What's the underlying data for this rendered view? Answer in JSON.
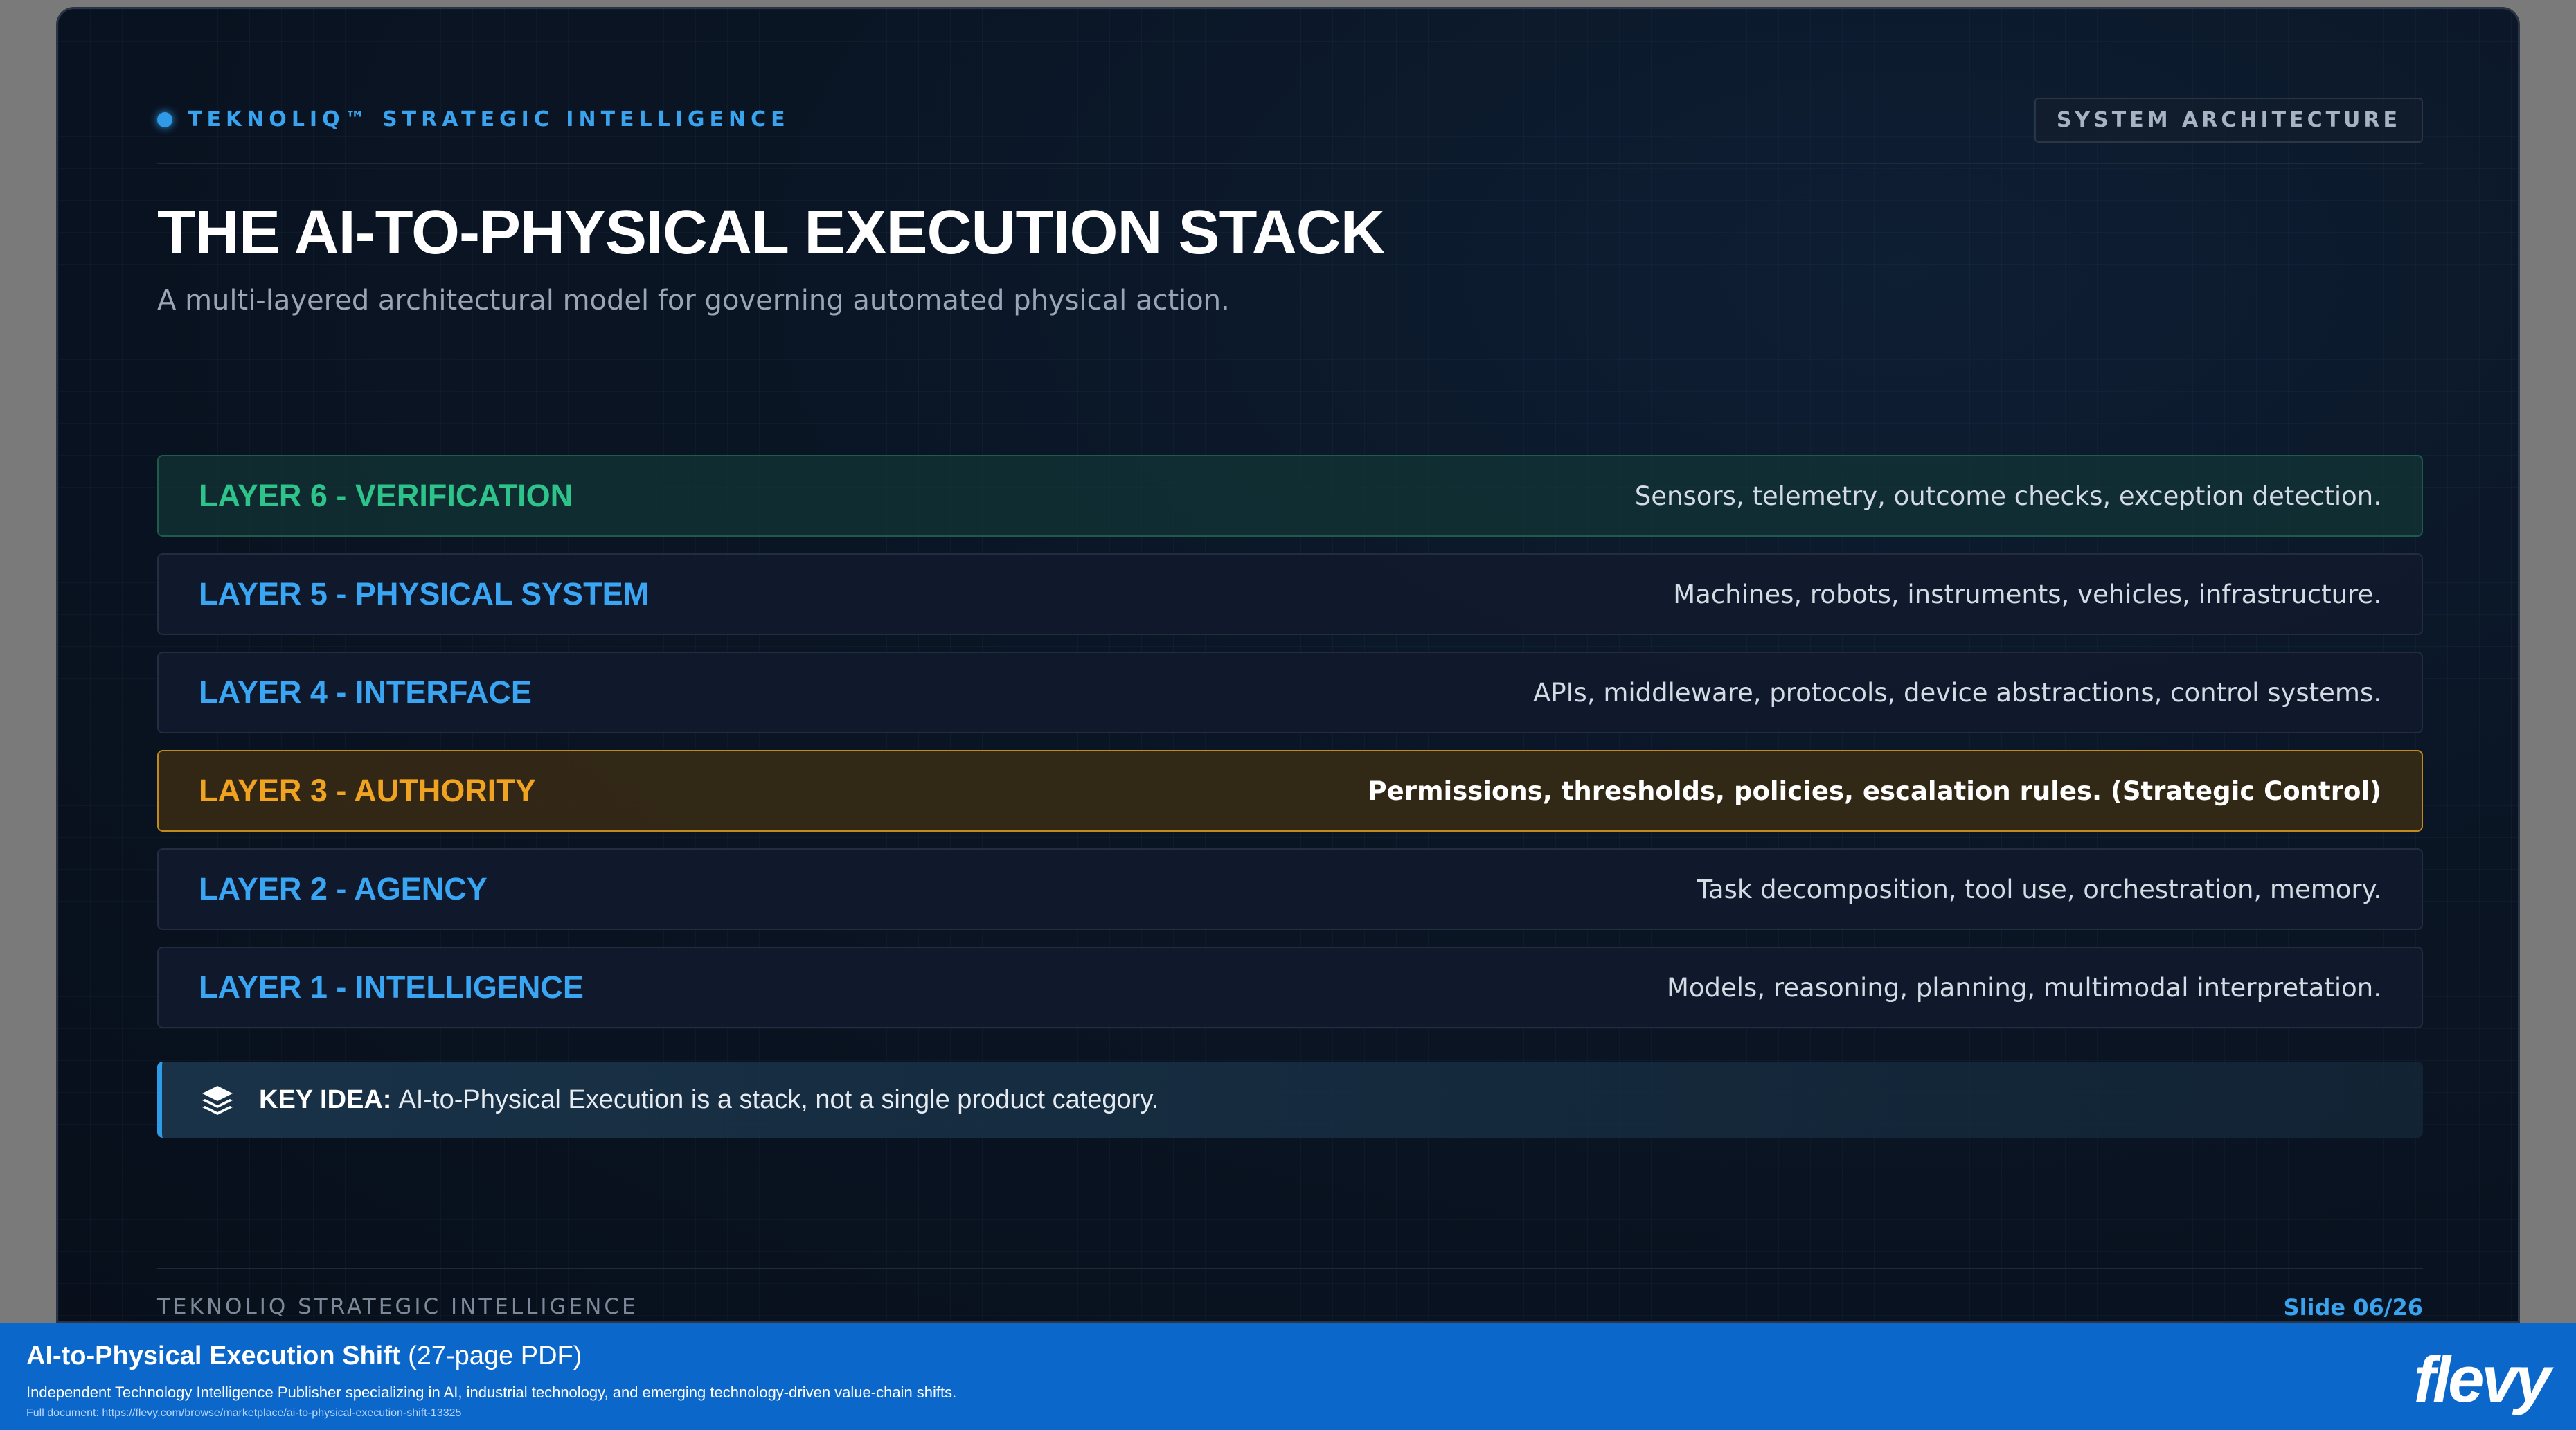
{
  "header": {
    "brand": "TEKNOLIQ™ STRATEGIC INTELLIGENCE",
    "tag": "SYSTEM ARCHITECTURE"
  },
  "title": "THE AI-TO-PHYSICAL EXECUTION STACK",
  "subtitle": "A multi-layered architectural model for governing automated physical action.",
  "layers": [
    {
      "name": "LAYER 6 - VERIFICATION",
      "desc": "Sensors, telemetry, outcome checks, exception detection."
    },
    {
      "name": "LAYER 5 - PHYSICAL SYSTEM",
      "desc": "Machines, robots, instruments, vehicles, infrastructure."
    },
    {
      "name": "LAYER 4 - INTERFACE",
      "desc": "APIs, middleware, protocols, device abstractions, control systems."
    },
    {
      "name": "LAYER 3 - AUTHORITY",
      "desc": "Permissions, thresholds, policies, escalation rules. (Strategic Control)"
    },
    {
      "name": "LAYER 2 - AGENCY",
      "desc": "Task decomposition, tool use, orchestration, memory."
    },
    {
      "name": "LAYER 1 - INTELLIGENCE",
      "desc": "Models, reasoning, planning, multimodal interpretation."
    }
  ],
  "key_idea": {
    "icon": "layers-icon",
    "label": "KEY IDEA:",
    "text": "AI-to-Physical Execution is a stack, not a single product category."
  },
  "footer": {
    "left": "TEKNOLIQ STRATEGIC INTELLIGENCE",
    "right": "Slide 06/26"
  },
  "banner": {
    "title": "AI-to-Physical Execution Shift",
    "pages": "(27-page PDF)",
    "description": "Independent Technology Intelligence Publisher specializing in AI, industrial technology, and emerging technology-driven value-chain shifts.",
    "link": "Full document: https://flevy.com/browse/marketplace/ai-to-physical-execution-shift-13325",
    "logo": "flevy"
  },
  "colors": {
    "accent_blue": "#3aa3ee",
    "verification_green": "#2ec38a",
    "authority_amber": "#f0a321",
    "banner_blue": "#0b67c9"
  }
}
